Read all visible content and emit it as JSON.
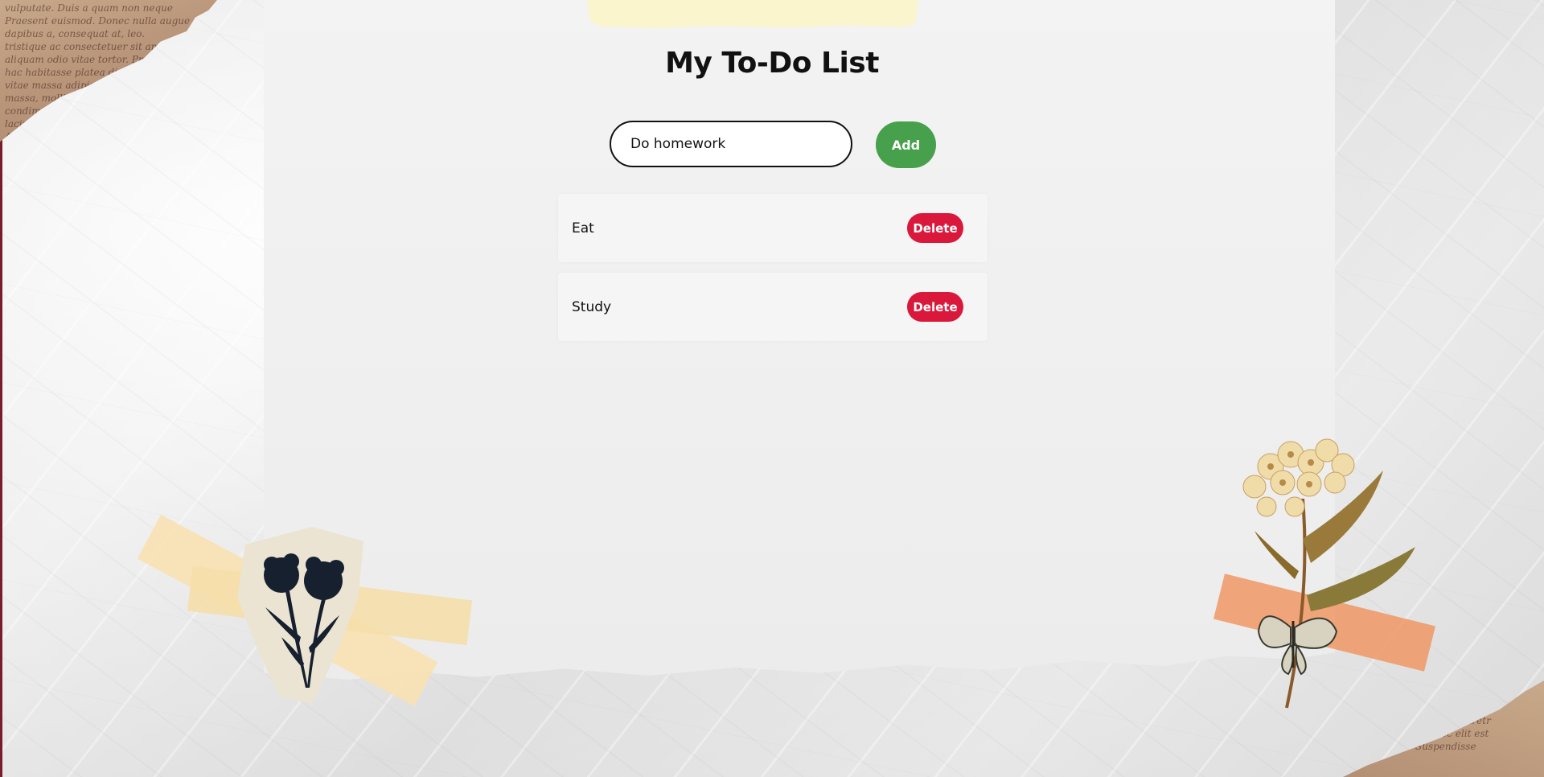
{
  "app": {
    "title": "My To-Do List"
  },
  "input": {
    "value": "Do homework",
    "placeholder": ""
  },
  "buttons": {
    "add_label": "Add",
    "delete_label": "Delete"
  },
  "todos": [
    {
      "text": "Eat"
    },
    {
      "text": "Study"
    }
  ],
  "colors": {
    "add_button": "#47a04b",
    "delete_button": "#d9183b",
    "sheet": "#f0f0f0"
  },
  "decor": {
    "top_left": "vintage-script-paper",
    "bottom_right": "vintage-script-paper",
    "bottom_left_sticker": "dark-flower-sticker",
    "bottom_right_sticker": "pressed-flower-butterfly-sticker"
  }
}
